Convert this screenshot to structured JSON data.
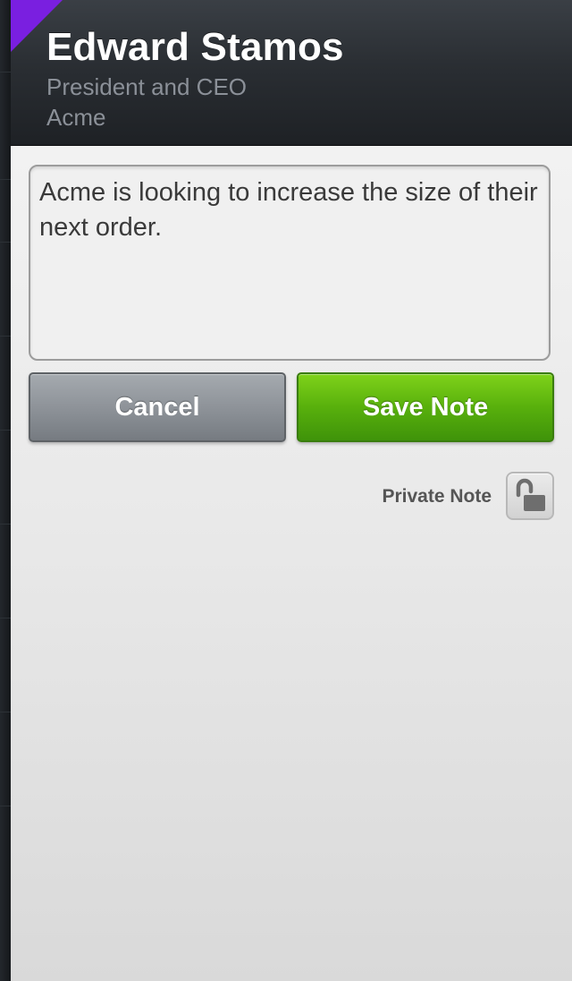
{
  "contact": {
    "name": "Edward Stamos",
    "title": "President and CEO",
    "company": "Acme"
  },
  "note": {
    "text": "Acme is looking to increase the size of their next order."
  },
  "actions": {
    "cancel_label": "Cancel",
    "save_label": "Save Note"
  },
  "privacy": {
    "label": "Private Note",
    "icon": "unlocked-padlock-icon",
    "locked": false
  },
  "colors": {
    "accent": "#7a1fe0",
    "save_green": "#58b00c",
    "cancel_gray": "#8e9399"
  }
}
